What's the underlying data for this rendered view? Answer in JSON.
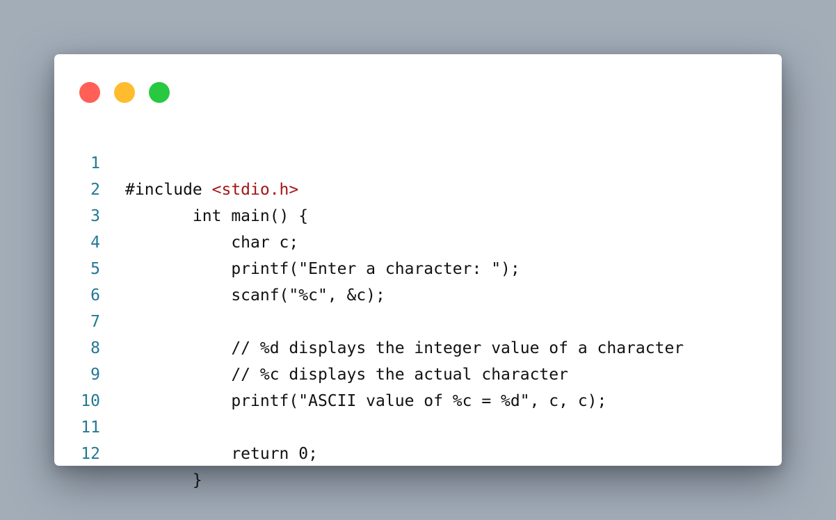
{
  "window": {
    "controls": [
      {
        "name": "close",
        "color": "#ff5f57"
      },
      {
        "name": "minimize",
        "color": "#febc2e"
      },
      {
        "name": "zoom",
        "color": "#28c840"
      }
    ]
  },
  "colors": {
    "background": "#a3adb8",
    "line_number": "#237893",
    "code_text": "#111111",
    "include_string": "#a31515"
  },
  "code": {
    "language": "c",
    "lines": [
      {
        "number": "1",
        "text": "#include ",
        "highlight": "<stdio.h>"
      },
      {
        "number": "2",
        "text": "       int main() {"
      },
      {
        "number": "3",
        "text": "           char c;"
      },
      {
        "number": "4",
        "text": "           printf(\"Enter a character: \");"
      },
      {
        "number": "5",
        "text": "           scanf(\"%c\", &c);"
      },
      {
        "number": "6",
        "text": ""
      },
      {
        "number": "7",
        "text": "           // %d displays the integer value of a character"
      },
      {
        "number": "8",
        "text": "           // %c displays the actual character"
      },
      {
        "number": "9",
        "text": "           printf(\"ASCII value of %c = %d\", c, c);"
      },
      {
        "number": "10",
        "text": ""
      },
      {
        "number": "11",
        "text": "           return 0;"
      },
      {
        "number": "12",
        "text": "       }"
      }
    ]
  }
}
